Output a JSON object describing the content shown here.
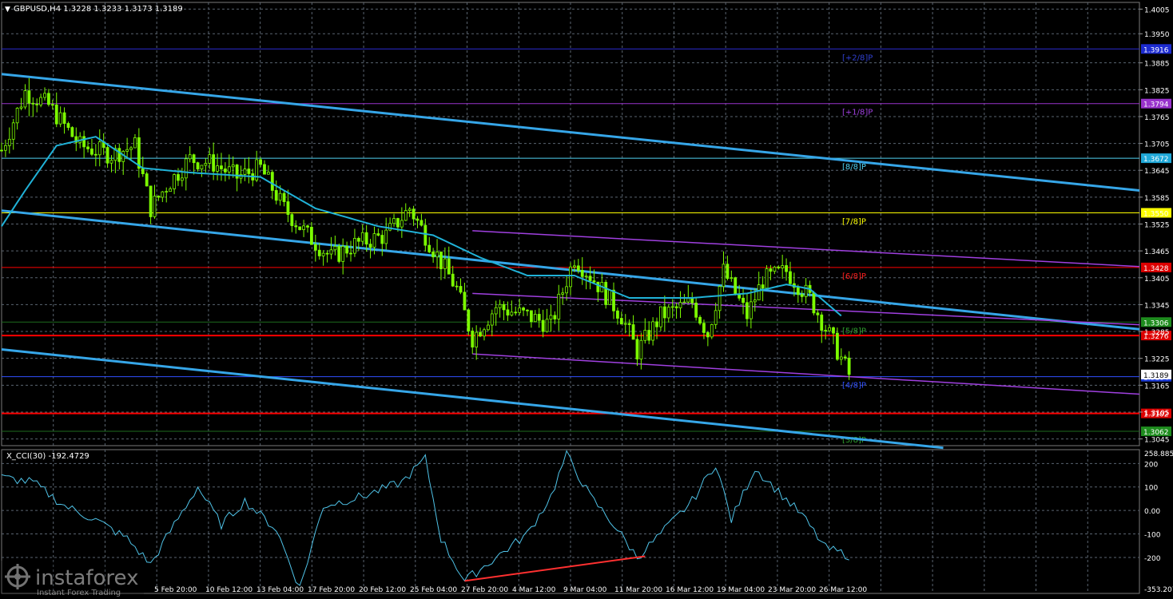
{
  "header": {
    "symbol_line": "GBPUSD,H4  1.3228 1.3233 1.3173 1.3189"
  },
  "colors": {
    "background": "#000000",
    "grid": "#5a6470",
    "candle_up": "#7cfc00",
    "candle_down": "#7cfc00",
    "ma_line": "#20b2d8",
    "channel_blue": "#36a6e8",
    "channel_violet": "#a040e0",
    "level_red": "#ff0000",
    "cci_line": "#4fc3e8",
    "divergence": "#ff3030"
  },
  "price_axis": {
    "ticks": [
      "1.4005",
      "1.3950",
      "1.3885",
      "1.3825",
      "1.3765",
      "1.3705",
      "1.3645",
      "1.3585",
      "1.3525",
      "1.3465",
      "1.3405",
      "1.3345",
      "1.3285",
      "1.3225",
      "1.3165",
      "1.3105",
      "1.3045"
    ]
  },
  "time_axis": {
    "labels": [
      "",
      "5 Feb 20:00",
      "10 Feb 12:00",
      "13 Feb 04:00",
      "17 Feb 20:00",
      "20 Feb 12:00",
      "25 Feb 04:00",
      "27 Feb 20:00",
      "4 Mar 12:00",
      "9 Mar 04:00",
      "11 Mar 20:00",
      "16 Mar 12:00",
      "19 Mar 04:00",
      "23 Mar 20:00",
      "26 Mar 12:00"
    ]
  },
  "murrey_levels": [
    {
      "label": "[+2/8]P",
      "price": 1.3916,
      "tag": "1.3916",
      "color": "#2a2ad0",
      "tag_bg": "#1c2bd0",
      "label_color": "#3040d0"
    },
    {
      "label": "[+1/8]P",
      "price": 1.3794,
      "tag": "1.3794",
      "color": "#9932cc",
      "tag_bg": "#9932cc",
      "label_color": "#a040e0"
    },
    {
      "label": "[8/8]P",
      "price": 1.3672,
      "tag": "1.3672",
      "color": "#4fd0f0",
      "tag_bg": "#1fa8d8",
      "label_color": "#4fd0f0"
    },
    {
      "label": "[7/8]P",
      "price": 1.355,
      "tag": "1.3550",
      "color": "#ffff00",
      "tag_bg": "#ffff00",
      "label_color": "#ffff00"
    },
    {
      "label": "[6/8]P",
      "price": 1.3428,
      "tag": "1.3428",
      "color": "#ff0000",
      "tag_bg": "#dd0000",
      "label_color": "#ff2020"
    },
    {
      "label": "[5/8]P",
      "price": 1.3306,
      "tag": "1.3306",
      "color": "#1e6b1e",
      "tag_bg": "#1e8c1e",
      "label_color": "#2ea02e"
    },
    {
      "label": "[4/8]P",
      "price": 1.3184,
      "tag": "1.3184",
      "color": "#3050ff",
      "tag_bg": "#1c3bd8",
      "label_color": "#3050ff"
    },
    {
      "label": "[3/8]P",
      "price": 1.3062,
      "tag": "1.3062",
      "color": "#1e6b1e",
      "tag_bg": "#1e8c1e",
      "label_color": "#2ea02e"
    }
  ],
  "support_resistance": [
    {
      "price": 1.3276,
      "tag": "1.3276",
      "color": "#ff0000"
    },
    {
      "price": 1.3102,
      "tag": "1.3102",
      "color": "#ff0000"
    }
  ],
  "current_price_tag": "1.3189",
  "indicator": {
    "title": "X_CCI(30) -192.4729",
    "axis_ticks": [
      "258.8859",
      "200",
      "100",
      "0.00",
      "-100",
      "-200",
      "-353.207"
    ]
  },
  "watermark": {
    "brand": "instaforex",
    "tagline": "Instant Forex Trading"
  },
  "chart_data": {
    "type": "candlestick",
    "title": "GBPUSD,H4",
    "ohlc_last": {
      "open": 1.3228,
      "high": 1.3233,
      "low": 1.3173,
      "close": 1.3189
    },
    "ylim": [
      1.303,
      1.402
    ],
    "grid": true,
    "x_labels": [
      "5 Feb 20:00",
      "10 Feb 12:00",
      "13 Feb 04:00",
      "17 Feb 20:00",
      "20 Feb 12:00",
      "25 Feb 04:00",
      "27 Feb 20:00",
      "4 Mar 12:00",
      "9 Mar 04:00",
      "11 Mar 20:00",
      "16 Mar 12:00",
      "19 Mar 04:00",
      "23 Mar 20:00",
      "26 Mar 12:00"
    ],
    "price_path_anchors": [
      [
        0,
        1.369
      ],
      [
        6,
        1.382
      ],
      [
        12,
        1.379
      ],
      [
        20,
        1.37
      ],
      [
        28,
        1.368
      ],
      [
        34,
        1.37
      ],
      [
        38,
        1.356
      ],
      [
        42,
        1.361
      ],
      [
        48,
        1.367
      ],
      [
        54,
        1.366
      ],
      [
        60,
        1.363
      ],
      [
        66,
        1.365
      ],
      [
        72,
        1.356
      ],
      [
        78,
        1.35
      ],
      [
        84,
        1.345
      ],
      [
        90,
        1.348
      ],
      [
        98,
        1.35
      ],
      [
        104,
        1.356
      ],
      [
        110,
        1.347
      ],
      [
        116,
        1.338
      ],
      [
        120,
        1.327
      ],
      [
        126,
        1.334
      ],
      [
        134,
        1.332
      ],
      [
        140,
        1.33
      ],
      [
        146,
        1.345
      ],
      [
        152,
        1.339
      ],
      [
        158,
        1.332
      ],
      [
        162,
        1.324
      ],
      [
        168,
        1.332
      ],
      [
        176,
        1.335
      ],
      [
        180,
        1.328
      ],
      [
        184,
        1.342
      ],
      [
        190,
        1.332
      ],
      [
        194,
        1.34
      ],
      [
        200,
        1.342
      ],
      [
        206,
        1.336
      ],
      [
        212,
        1.326
      ],
      [
        216,
        1.3189
      ]
    ],
    "moving_average_anchors": [
      [
        0,
        1.352
      ],
      [
        6,
        1.36
      ],
      [
        14,
        1.37
      ],
      [
        24,
        1.372
      ],
      [
        36,
        1.365
      ],
      [
        48,
        1.364
      ],
      [
        66,
        1.363
      ],
      [
        80,
        1.356
      ],
      [
        96,
        1.352
      ],
      [
        110,
        1.35
      ],
      [
        122,
        1.345
      ],
      [
        134,
        1.341
      ],
      [
        146,
        1.341
      ],
      [
        160,
        1.336
      ],
      [
        176,
        1.336
      ],
      [
        190,
        1.337
      ],
      [
        200,
        1.339
      ],
      [
        206,
        1.338
      ],
      [
        214,
        1.332
      ]
    ],
    "channel_lines": [
      {
        "x1": 0,
        "y1": 1.386,
        "x2": 290,
        "y2": 1.36,
        "color": "blue"
      },
      {
        "x1": 0,
        "y1": 1.3555,
        "x2": 290,
        "y2": 1.329,
        "color": "blue"
      },
      {
        "x1": 0,
        "y1": 1.3245,
        "x2": 240,
        "y2": 1.3025,
        "color": "blue"
      },
      {
        "x1": 120,
        "y1": 1.351,
        "x2": 290,
        "y2": 1.343,
        "color": "violet"
      },
      {
        "x1": 120,
        "y1": 1.337,
        "x2": 290,
        "y2": 1.33,
        "color": "violet"
      },
      {
        "x1": 120,
        "y1": 1.3235,
        "x2": 290,
        "y2": 1.3145,
        "color": "violet"
      }
    ],
    "cci": {
      "anchors": [
        [
          0,
          140
        ],
        [
          8,
          120
        ],
        [
          16,
          20
        ],
        [
          24,
          -40
        ],
        [
          32,
          -120
        ],
        [
          38,
          -230
        ],
        [
          44,
          -60
        ],
        [
          50,
          100
        ],
        [
          56,
          -60
        ],
        [
          62,
          40
        ],
        [
          70,
          -80
        ],
        [
          76,
          -330
        ],
        [
          82,
          20
        ],
        [
          92,
          60
        ],
        [
          102,
          120
        ],
        [
          108,
          220
        ],
        [
          112,
          -120
        ],
        [
          118,
          -300
        ],
        [
          126,
          -200
        ],
        [
          134,
          -100
        ],
        [
          140,
          60
        ],
        [
          144,
          240
        ],
        [
          150,
          60
        ],
        [
          156,
          -60
        ],
        [
          162,
          -200
        ],
        [
          168,
          -100
        ],
        [
          176,
          40
        ],
        [
          182,
          200
        ],
        [
          186,
          -40
        ],
        [
          192,
          180
        ],
        [
          198,
          80
        ],
        [
          204,
          -20
        ],
        [
          210,
          -160
        ],
        [
          216,
          -192
        ]
      ],
      "ylim": [
        -353.207,
        258.8859
      ],
      "divergence_line": [
        [
          118,
          -300
        ],
        [
          164,
          -195
        ]
      ]
    }
  }
}
